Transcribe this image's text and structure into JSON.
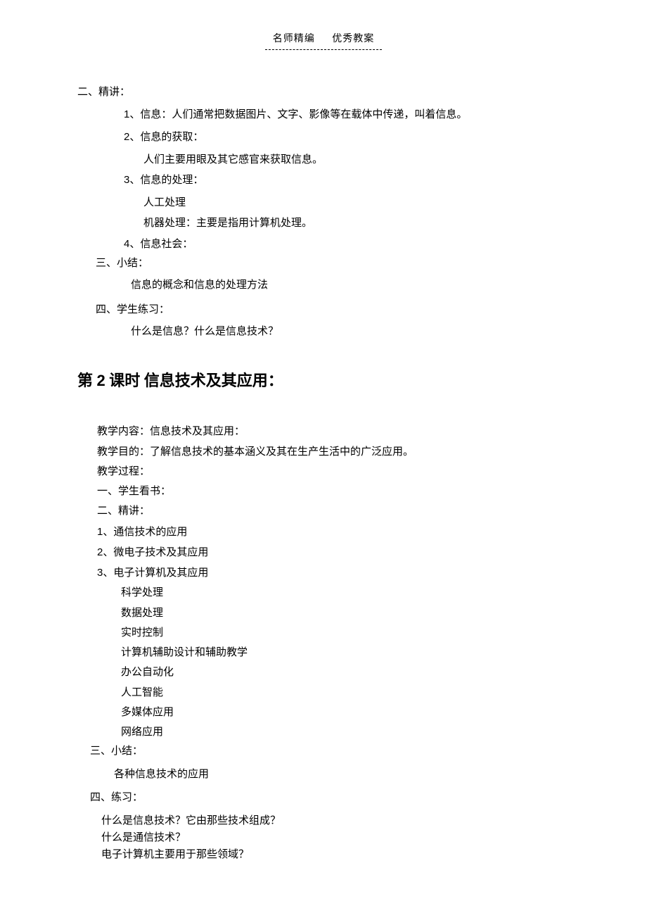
{
  "header": {
    "left": "名师精编",
    "right": "优秀教案"
  },
  "section1": {
    "h_jingjiang": "二、精讲：",
    "p1_num": "1",
    "p1": "、信息：人们通常把数据图片、文字、影像等在载体中传递，叫着信息。",
    "p2_num": "2",
    "p2": "、信息的获取：",
    "p2_body": "人们主要用眼及其它感官来获取信息。",
    "p3_num": "3",
    "p3": "、信息的处理：",
    "p3_a": "人工处理",
    "p3_b": "机器处理：主要是指用计算机处理。",
    "p4_num": "4",
    "p4": "、信息社会：",
    "h_xiaojie": "三、小结：",
    "xiaojie_body": "信息的概念和信息的处理方法",
    "h_lianxi": "四、学生练习：",
    "lianxi_body": "什么是信息？什么是信息技术？"
  },
  "section2": {
    "title_pre": "第 ",
    "title_num": "2",
    "title_post": " 课时  信息技术及其应用：",
    "l_content": "教学内容：信息技术及其应用：",
    "l_goal": "教学目的：了解信息技术的基本涵义及其在生产生活中的广泛应用。",
    "l_proc": "教学过程：",
    "l_read": "一、学生看书：",
    "l_jing": "二、精讲：",
    "l1_num": "1",
    "l1": "、通信技术的应用",
    "l2_num": "2",
    "l2": "、微电子技术及其应用",
    "l3_num": "3",
    "l3": "、电子计算机及其应用",
    "sub_a": "科学处理",
    "sub_b": "数据处理",
    "sub_c": "实时控制",
    "sub_d": "计算机辅助设计和辅助教学",
    "sub_e": "办公自动化",
    "sub_f": "人工智能",
    "sub_g": "多媒体应用",
    "sub_h": "网络应用",
    "h_xiaojie": "三、小结：",
    "xiaojie_body": "各种信息技术的应用",
    "h_lianxi": "四、练习：",
    "ex1": "什么是信息技术？它由那些技术组成？",
    "ex2": "什么是通信技术？",
    "ex3": "电子计算机主要用于那些领域？"
  }
}
